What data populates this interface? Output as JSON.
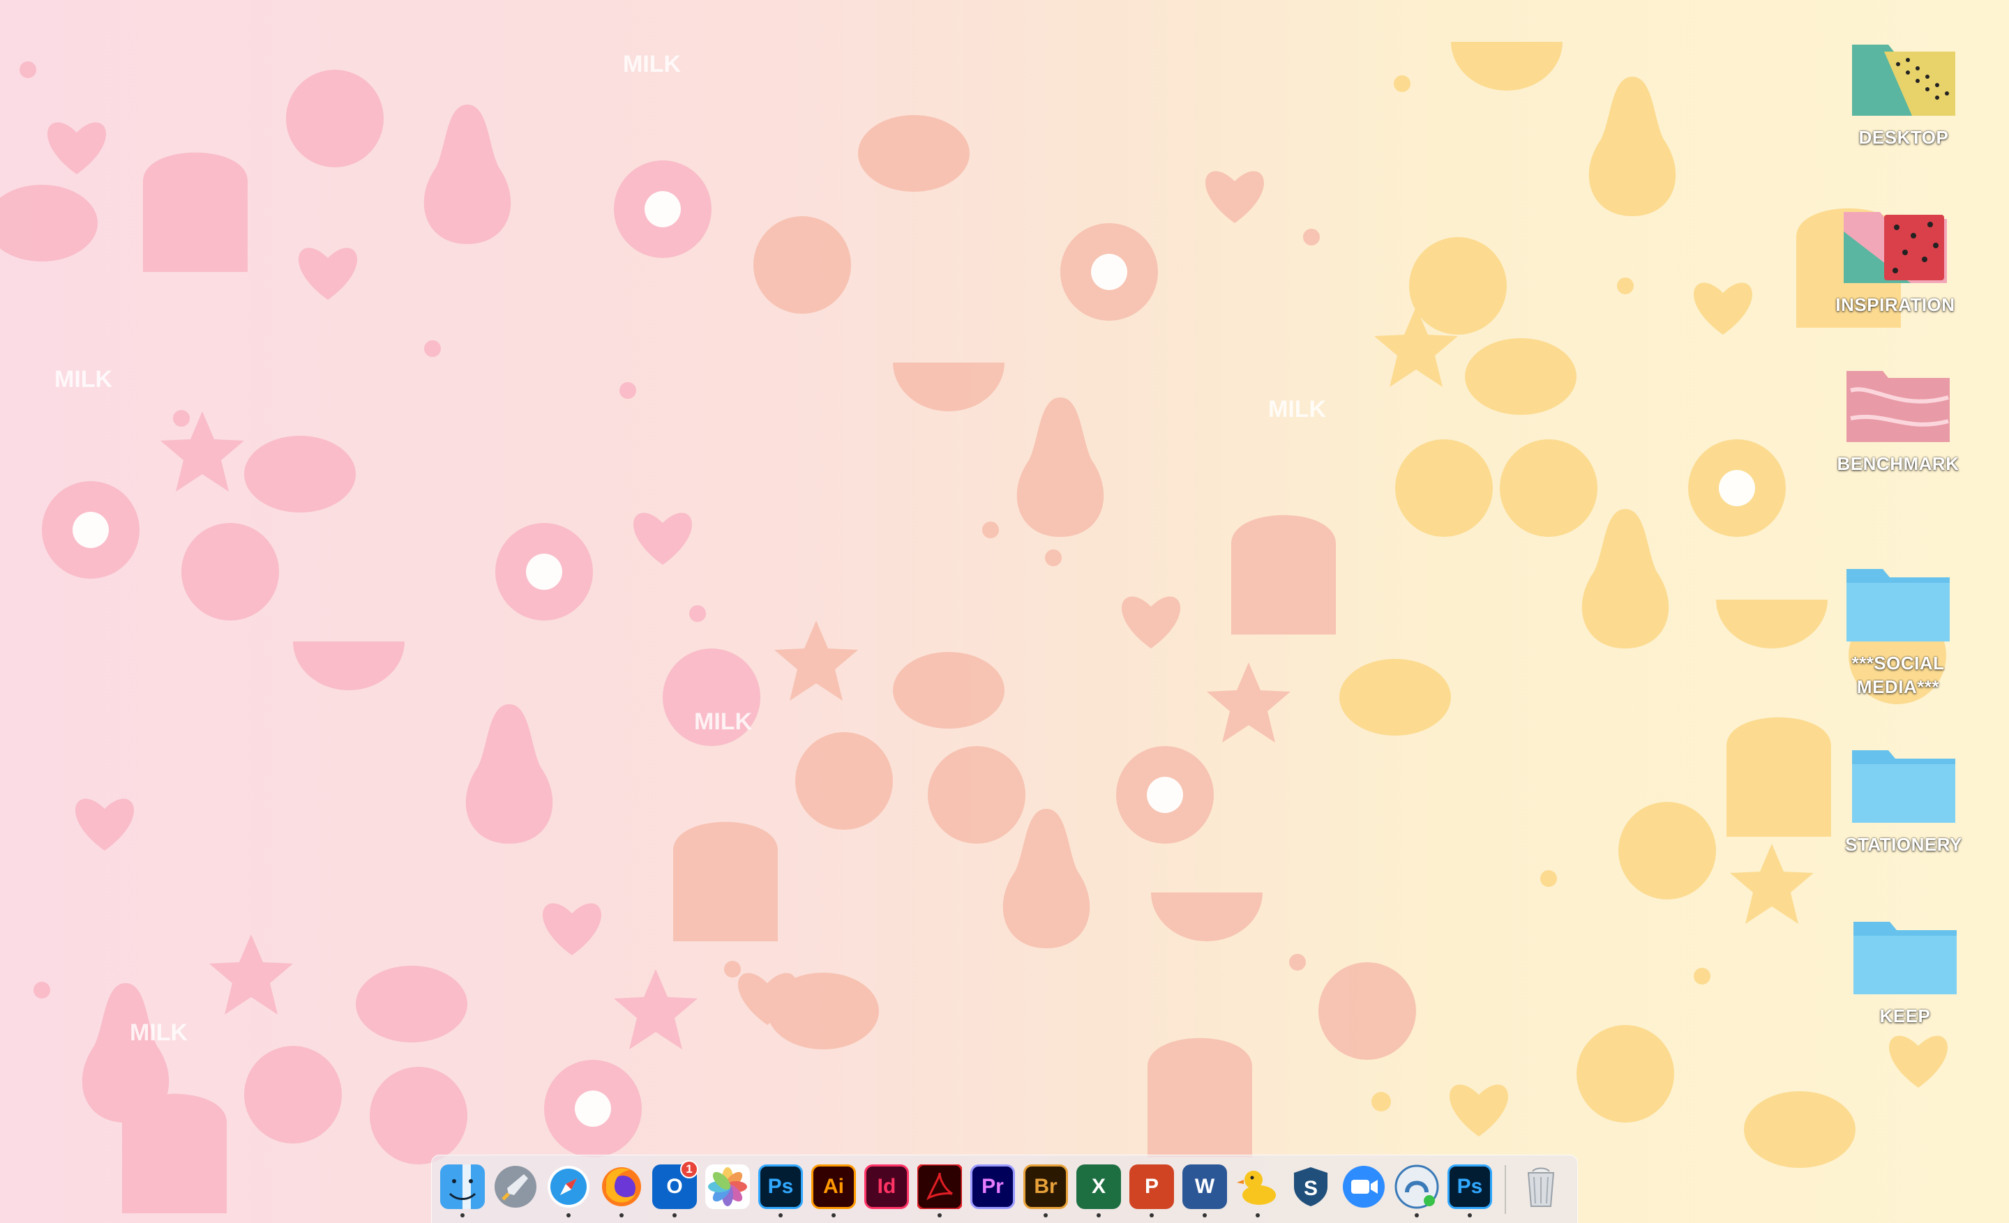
{
  "desktop": {
    "icons": [
      {
        "label": "DESKTOP"
      },
      {
        "label": "INSPIRATION"
      },
      {
        "label": "BENCHMARK"
      },
      {
        "label": "***SOCIAL MEDIA***"
      },
      {
        "label": "STATIONERY"
      },
      {
        "label": "KEEP"
      }
    ],
    "wallpaper_text": {
      "milk": "MILK"
    }
  },
  "dock": {
    "apps": [
      {
        "name": "Finder",
        "icon": "finder-icon",
        "running": true
      },
      {
        "name": "Launchpad",
        "icon": "rocket-icon",
        "running": false
      },
      {
        "name": "Safari",
        "icon": "compass-icon",
        "running": true
      },
      {
        "name": "Firefox",
        "icon": "firefox-icon",
        "running": true
      },
      {
        "name": "Outlook",
        "icon": "outlook-icon",
        "glyph": "O",
        "badge": "1",
        "running": true
      },
      {
        "name": "Photos",
        "icon": "photos-icon",
        "running": false
      },
      {
        "name": "Photoshop",
        "icon": "photoshop-icon",
        "glyph": "Ps",
        "running": true
      },
      {
        "name": "Illustrator",
        "icon": "illustrator-icon",
        "glyph": "Ai",
        "running": true
      },
      {
        "name": "InDesign",
        "icon": "indesign-icon",
        "glyph": "Id",
        "running": false
      },
      {
        "name": "Acrobat",
        "icon": "acrobat-icon",
        "running": true
      },
      {
        "name": "Premiere",
        "icon": "premiere-icon",
        "glyph": "Pr",
        "running": false
      },
      {
        "name": "Bridge",
        "icon": "bridge-icon",
        "glyph": "Br",
        "running": true
      },
      {
        "name": "Excel",
        "icon": "excel-icon",
        "glyph": "X",
        "running": true
      },
      {
        "name": "PowerPoint",
        "icon": "powerpoint-icon",
        "glyph": "P",
        "running": true
      },
      {
        "name": "Word",
        "icon": "word-icon",
        "glyph": "W",
        "running": true
      },
      {
        "name": "Cyberduck",
        "icon": "duck-icon",
        "running": true
      },
      {
        "name": "Shield",
        "icon": "shield-icon",
        "glyph": "S",
        "running": false
      },
      {
        "name": "Zoom",
        "icon": "zoom-icon",
        "running": false
      },
      {
        "name": "Screen Share",
        "icon": "screenshare-icon",
        "running": true
      },
      {
        "name": "Photoshop",
        "icon": "photoshop-icon",
        "glyph": "Ps",
        "running": true
      }
    ],
    "trash": {
      "name": "Trash",
      "icon": "trash-icon"
    }
  },
  "colors": {
    "pink": "#f7a6b8",
    "salmon": "#f5b3a2",
    "yellow": "#fcd77c",
    "folder_blue": "#6fc8f0"
  }
}
